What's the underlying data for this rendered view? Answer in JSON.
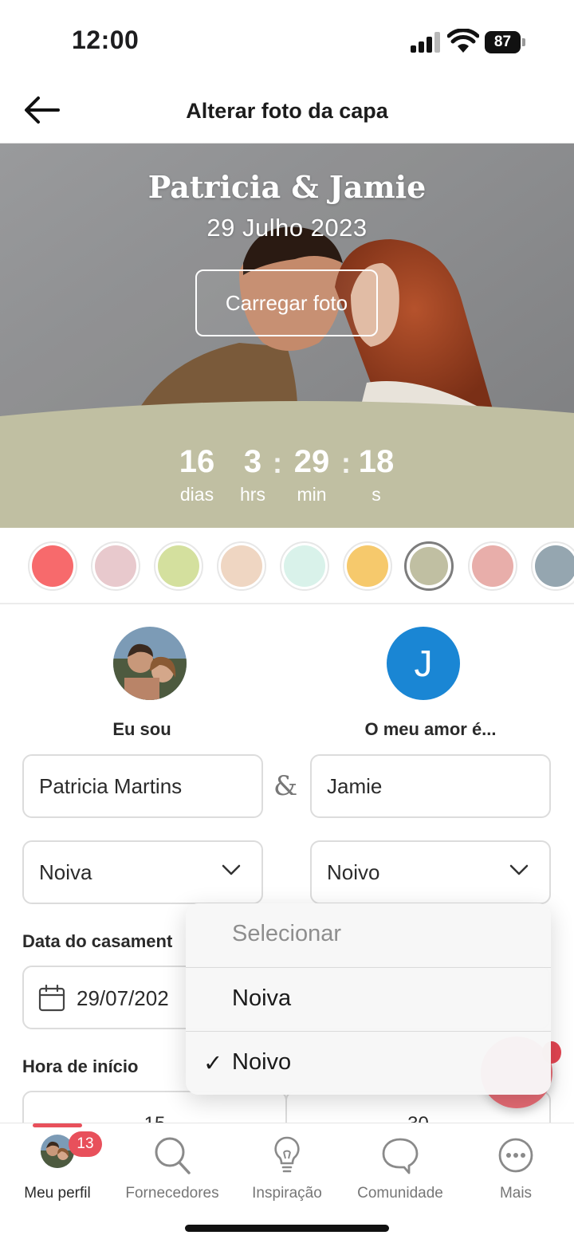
{
  "status_bar": {
    "time": "12:00",
    "battery": "87"
  },
  "header": {
    "title": "Alterar foto da capa"
  },
  "cover": {
    "couple_names": "Patricia & Jamie",
    "date": "29 Julho 2023",
    "upload_label": "Carregar foto",
    "band_color": "#c0bfa2",
    "countdown": [
      {
        "value": "16",
        "label": "dias"
      },
      {
        "value": "3",
        "label": "hrs"
      },
      {
        "value": "29",
        "label": "min"
      },
      {
        "value": "18",
        "label": "s"
      }
    ]
  },
  "swatches": {
    "colors": [
      "#f76a6c",
      "#e8c9cd",
      "#d4e09e",
      "#efd6c2",
      "#d9f2ea",
      "#f6c96c",
      "#c0bfa2",
      "#e8aeaa",
      "#95a6b0"
    ],
    "selected": "#c0bfa2"
  },
  "partners": {
    "me_label": "Eu sou",
    "partner_label": "O meu amor é...",
    "partner_initial": "J",
    "me_name": "Patricia Martins",
    "partner_name": "Jamie",
    "ampersand": "&",
    "me_role": "Noiva",
    "partner_role": "Noivo"
  },
  "wedding": {
    "date_label": "Data do casament",
    "date_value": "29/07/202",
    "start_label": "Hora de início",
    "start_hour": "15",
    "start_minute": "30"
  },
  "dropdown": {
    "placeholder": "Selecionar",
    "options": [
      "Noiva",
      "Noivo"
    ],
    "selected": "Noivo",
    "check": "✓"
  },
  "tabbar": {
    "badge": "13",
    "items": [
      {
        "label": "Meu perfil",
        "icon": "profile-avatar-icon"
      },
      {
        "label": "Fornecedores",
        "icon": "search-icon"
      },
      {
        "label": "Inspiração",
        "icon": "lightbulb-icon"
      },
      {
        "label": "Comunidade",
        "icon": "chat-bubble-icon"
      },
      {
        "label": "Mais",
        "icon": "more-icon"
      }
    ]
  },
  "colors": {
    "accent": "#e8505b",
    "avatar_blue": "#1a86d4"
  }
}
